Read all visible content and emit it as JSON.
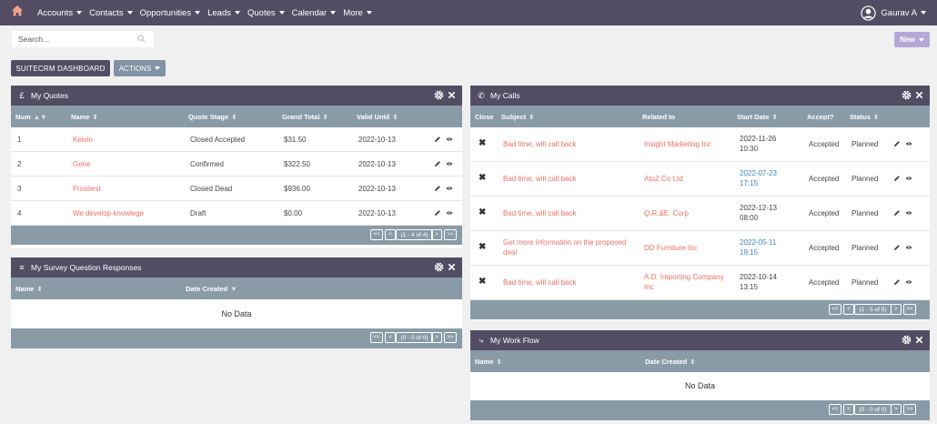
{
  "nav": {
    "items": [
      {
        "label": "Accounts"
      },
      {
        "label": "Contacts"
      },
      {
        "label": "Opportunities"
      },
      {
        "label": "Leads"
      },
      {
        "label": "Quotes"
      },
      {
        "label": "Calendar"
      },
      {
        "label": "More"
      }
    ],
    "user": "Gaurav A"
  },
  "search": {
    "placeholder": "Search..."
  },
  "toolbar": {
    "new_label": "New",
    "dashboard_label": "SUITECRM DASHBOARD",
    "actions_label": "ACTIONS"
  },
  "colors": {
    "nav_bg": "#534d64",
    "header_bg": "#8a9ba8",
    "link": "#ee6f63",
    "date_link": "#3c83c3",
    "new_button": "#b5a8d9"
  },
  "quotes": {
    "title": "My Quotes",
    "columns": {
      "num": "Num",
      "name": "Name",
      "stage": "Quote Stage",
      "total": "Grand Total",
      "valid": "Valid Until"
    },
    "rows": [
      {
        "num": "1",
        "name": "Kelvin",
        "stage": "Closed Accepted",
        "total": "$31.50",
        "valid": "2022-10-13"
      },
      {
        "num": "2",
        "name": "Gene",
        "stage": "Confirmed",
        "total": "$322.50",
        "valid": "2022-10-13"
      },
      {
        "num": "3",
        "name": "Frostiest",
        "stage": "Closed Dead",
        "total": "$936.00",
        "valid": "2022-10-13"
      },
      {
        "num": "4",
        "name": "We develop knowlege",
        "stage": "Draft",
        "total": "$0.00",
        "valid": "2022-10-13"
      }
    ],
    "pagination": "(1 - 4 of 4)"
  },
  "survey": {
    "title": "My Survey Question Responses",
    "columns": {
      "name": "Name",
      "date": "Date Created"
    },
    "empty": "No Data",
    "pagination": "(0 - 0 of 0)"
  },
  "calls": {
    "title": "My Calls",
    "columns": {
      "close": "Close",
      "subject": "Subject",
      "related": "Related to",
      "start": "Start Date",
      "accept": "Accept?",
      "status": "Status"
    },
    "rows": [
      {
        "subject": "Bad time, will call back",
        "related": "Insight Marketing Inc",
        "start": "2022-11-26 10:30",
        "accept": "Accepted",
        "status": "Planned",
        "future": false
      },
      {
        "subject": "Bad time, will call back",
        "related": "AtoZ Co Ltd",
        "start": "2022-07-23 17:15",
        "accept": "Accepted",
        "status": "Planned",
        "future": true
      },
      {
        "subject": "Bad time, will call back",
        "related": "Q.R.&E. Corp",
        "start": "2022-12-13 08:00",
        "accept": "Accepted",
        "status": "Planned",
        "future": false
      },
      {
        "subject": "Get more information on the proposed deal",
        "related": "DD Furniture Inc",
        "start": "2022-05-11 19:15",
        "accept": "Accepted",
        "status": "Planned",
        "future": true
      },
      {
        "subject": "Bad time, will call back",
        "related": "A.D. Importing Company Inc",
        "start": "2022-10-14 13:15",
        "accept": "Accepted",
        "status": "Planned",
        "future": false
      }
    ],
    "pagination": "(1 - 5 of 5)"
  },
  "workflow": {
    "title": "My Work Flow",
    "columns": {
      "name": "Name",
      "date": "Date Created"
    },
    "empty": "No Data",
    "pagination": "(0 - 0 of 0)"
  }
}
